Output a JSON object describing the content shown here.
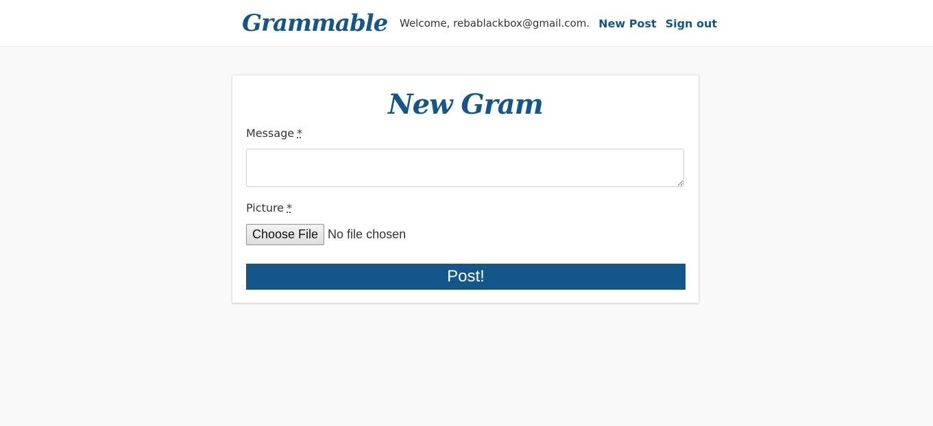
{
  "nav": {
    "brand": "Grammable",
    "welcome": "Welcome, rebablackbox@gmail.com.",
    "new_post": "New Post",
    "sign_out": "Sign out"
  },
  "form": {
    "title": "New Gram",
    "message_label": "Message",
    "picture_label": "Picture",
    "required_marker": "*",
    "message_value": "",
    "file_button": "Choose File",
    "file_status": "No file chosen",
    "submit": "Post!"
  },
  "colors": {
    "brand": "#13578a",
    "background": "#f9f9f9",
    "card": "#ffffff"
  }
}
